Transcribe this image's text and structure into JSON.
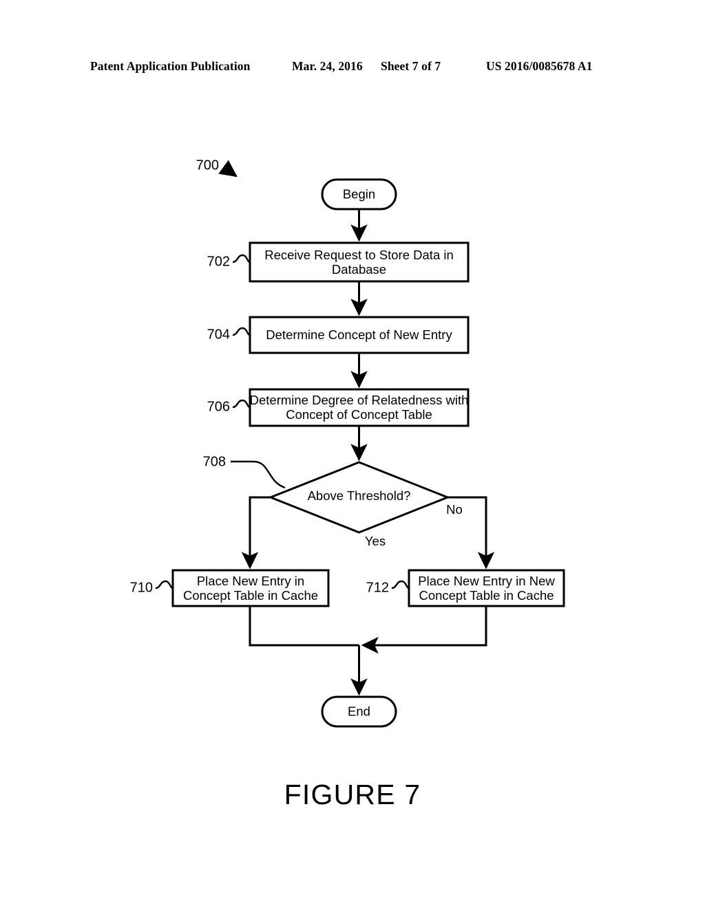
{
  "header": {
    "publication": "Patent Application Publication",
    "date": "Mar. 24, 2016",
    "sheet": "Sheet 7 of 7",
    "document_number": "US 2016/0085678 A1"
  },
  "figure": {
    "caption": "FIGURE 7",
    "diagram_label": "700"
  },
  "nodes": {
    "begin": {
      "label": "Begin"
    },
    "step_702": {
      "ref": "702",
      "line1": "Receive Request to Store Data in",
      "line2": "Database"
    },
    "step_704": {
      "ref": "704",
      "line1": "Determine Concept of New Entry",
      "line2": ""
    },
    "step_706": {
      "ref": "706",
      "line1": "Determine Degree of Relatedness with",
      "line2": "Concept of Concept Table"
    },
    "decision_708": {
      "ref": "708",
      "label": "Above Threshold?"
    },
    "step_710": {
      "ref": "710",
      "line1": "Place New Entry in",
      "line2": "Concept Table in Cache"
    },
    "step_712": {
      "ref": "712",
      "line1": "Place New Entry in New",
      "line2": "Concept Table in Cache"
    },
    "end": {
      "label": "End"
    }
  },
  "edges": {
    "yes_label": "Yes",
    "no_label": "No"
  },
  "colors": {
    "ink": "#000000",
    "paper": "#ffffff"
  }
}
